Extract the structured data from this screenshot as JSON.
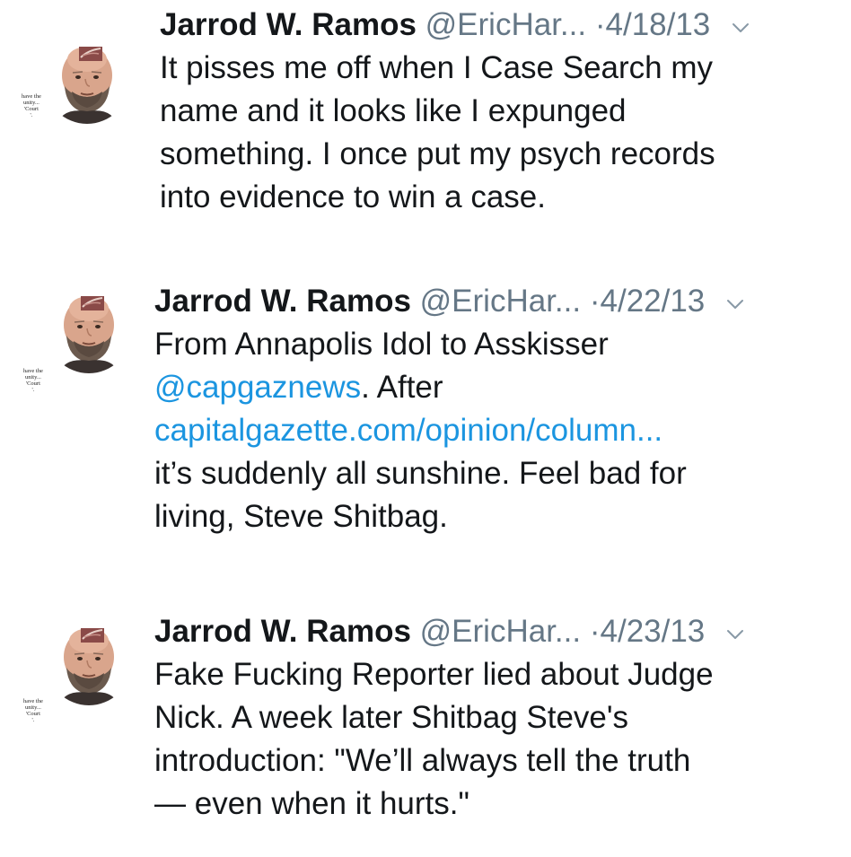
{
  "tweets": [
    {
      "name": "Jarrod W. Ramos",
      "handle": "@EricHar...",
      "dot": "·",
      "date": "4/18/13",
      "lines": [
        [
          {
            "text": "It pisses me off when I Case Search my"
          }
        ],
        [
          {
            "text": "name and it looks like I expunged"
          }
        ],
        [
          {
            "text": "something. I once put my psych records"
          }
        ],
        [
          {
            "text": "into evidence to win a case."
          }
        ]
      ],
      "avatar_caption": "have the\nunity...\n'Court\n'."
    },
    {
      "name": "Jarrod W. Ramos",
      "handle": "@EricHar...",
      "dot": "·",
      "date": "4/22/13",
      "lines": [
        [
          {
            "text": "From Annapolis Idol to Asskisser"
          }
        ],
        [
          {
            "text": "@capgaznews",
            "link": true
          },
          {
            "text": ". After"
          }
        ],
        [
          {
            "text": "capitalgazette.com/opinion/column...",
            "link": true
          }
        ],
        [
          {
            "text": "it’s suddenly all sunshine. Feel bad for"
          }
        ],
        [
          {
            "text": "living, Steve Shitbag."
          }
        ]
      ],
      "avatar_caption": "have the\nunity...\n'Court\n'."
    },
    {
      "name": "Jarrod W. Ramos",
      "handle": "@EricHar...",
      "dot": "·",
      "date": "4/23/13",
      "lines": [
        [
          {
            "text": "Fake Fucking Reporter lied about Judge"
          }
        ],
        [
          {
            "text": "Nick. A week later Shitbag Steve's"
          }
        ],
        [
          {
            "text": "introduction: \"We’ll always tell the truth"
          }
        ],
        [
          {
            "text": "— even when it hurts.\""
          }
        ]
      ],
      "avatar_caption": "have the\nunity...\n'Court\n'."
    }
  ],
  "colors": {
    "text": "#14171a",
    "secondary": "#657786",
    "link": "#1b95e0",
    "background": "#ffffff"
  },
  "icons": {
    "menu": "chevron-down-icon"
  }
}
